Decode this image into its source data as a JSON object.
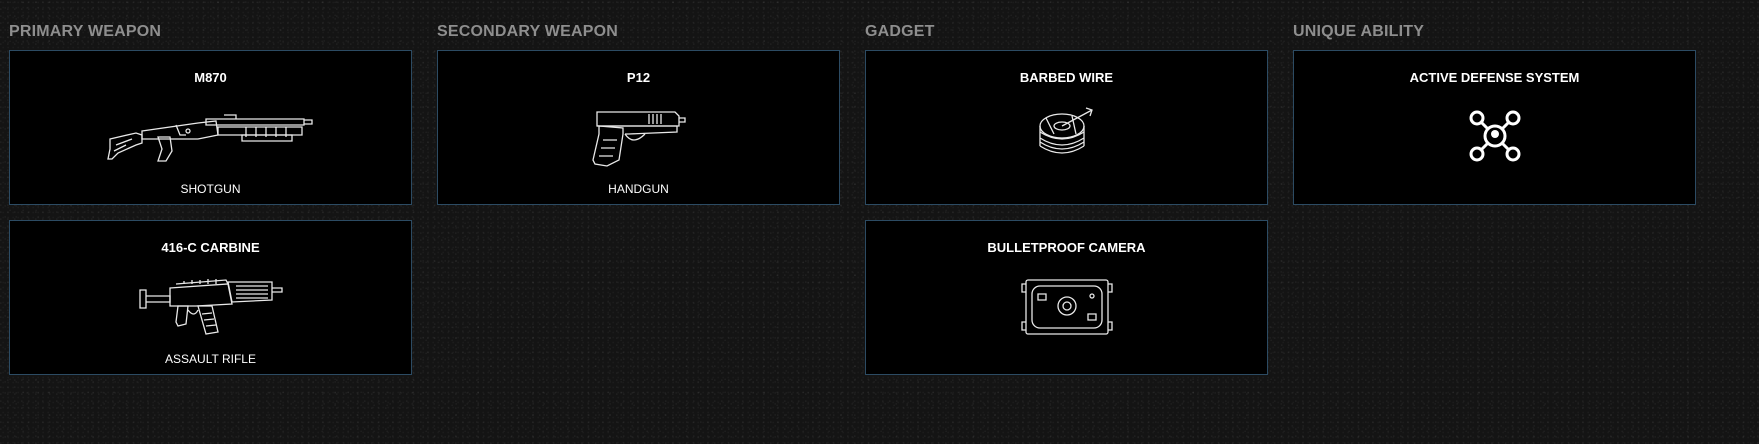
{
  "loadout": {
    "primary": {
      "title": "PRIMARY WEAPON",
      "items": [
        {
          "name": "M870",
          "type": "SHOTGUN",
          "icon": "shotgun-icon"
        },
        {
          "name": "416-C CARBINE",
          "type": "ASSAULT RIFLE",
          "icon": "assault-rifle-icon"
        }
      ]
    },
    "secondary": {
      "title": "SECONDARY WEAPON",
      "items": [
        {
          "name": "P12",
          "type": "HANDGUN",
          "icon": "handgun-icon"
        }
      ]
    },
    "gadget": {
      "title": "GADGET",
      "items": [
        {
          "name": "BARBED WIRE",
          "icon": "barbed-wire-icon"
        },
        {
          "name": "BULLETPROOF CAMERA",
          "icon": "bulletproof-camera-icon"
        }
      ]
    },
    "unique": {
      "title": "UNIQUE ABILITY",
      "items": [
        {
          "name": "ACTIVE DEFENSE SYSTEM",
          "icon": "active-defense-system-icon"
        }
      ]
    }
  },
  "colors": {
    "background": "#141414",
    "card_background": "#000000",
    "card_border": "#2c4b63",
    "column_title": "#8e8e8e",
    "text": "#ffffff"
  }
}
